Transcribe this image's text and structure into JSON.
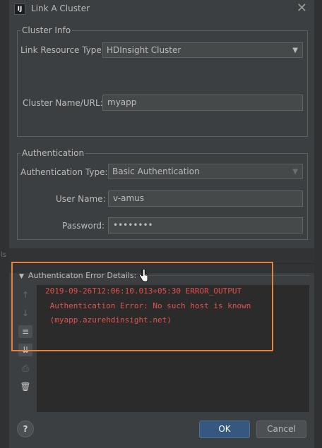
{
  "window": {
    "title": "Link A Cluster",
    "app_icon_letter": "IJ"
  },
  "cluster_info": {
    "legend": "Cluster Info",
    "link_resource_type_label": "Link Resource Type:",
    "link_resource_type_value": "HDInsight Cluster",
    "cluster_name_label": "Cluster Name/URL:",
    "cluster_name_value": "myapp"
  },
  "authentication": {
    "legend": "Authentication",
    "auth_type_label": "Authentication Type:",
    "auth_type_value": "Basic Authentication",
    "user_name_label": "User Name:",
    "user_name_value": "v-amus",
    "password_label": "Password:",
    "password_value": "••••••••"
  },
  "error_details": {
    "header": "Authenticaton Error Details:",
    "lines": [
      "2019-09-26T12:06:10.013+05:30 ERROR_OUTPUT",
      " Authentication Error: No such host is known",
      " (myapp.azurehdinsight.net)"
    ]
  },
  "console_tools": [
    {
      "name": "scroll-up-icon",
      "glyph": "↑",
      "active": false
    },
    {
      "name": "scroll-down-icon",
      "glyph": "↓",
      "active": false
    },
    {
      "name": "soft-wrap-icon",
      "glyph": "≡",
      "active": true
    },
    {
      "name": "scroll-to-end-icon",
      "glyph": "⇊",
      "active": true
    },
    {
      "name": "print-icon",
      "glyph": "⎙",
      "active": false
    },
    {
      "name": "trash-icon",
      "glyph": "🗑",
      "active": false
    }
  ],
  "footer": {
    "help_label": "?",
    "ok_label": "OK",
    "cancel_label": "Cancel"
  },
  "colors": {
    "error_text": "#e2534d",
    "highlight": "#e8823a",
    "ok_button": "#365880"
  }
}
